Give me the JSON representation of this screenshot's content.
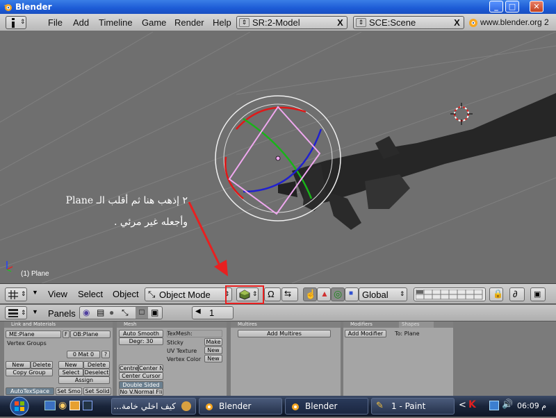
{
  "window": {
    "title": "Blender",
    "min_glyph": "_",
    "max_glyph": "□",
    "close_glyph": "✕"
  },
  "menubar": {
    "items": [
      "File",
      "Add",
      "Timeline",
      "Game",
      "Render",
      "Help"
    ],
    "screen_field": "SR:2-Model",
    "scene_field": "SCE:Scene",
    "close_glyph": "X",
    "dd_glyph": "⇕",
    "url": "www.blender.org 2"
  },
  "viewport": {
    "annotation_line1": "٢ إذهب هنا ثم أقلب الـ Plane",
    "annotation_line2": "وأجعله غير مرئي .",
    "object_label": "(1) Plane",
    "colors": {
      "background": "#6f6f6f",
      "arrow": "#e82020"
    }
  },
  "header3d": {
    "view": "View",
    "select": "Select",
    "object": "Object",
    "mode": "Object Mode",
    "orientation": "Global"
  },
  "buttons_header": {
    "panels": "Panels",
    "frame": "1"
  },
  "panels": {
    "link_materials": {
      "title": "Link and Materials",
      "me": "ME:Plane",
      "f": "F",
      "ob": "OB:Plane",
      "vertex_groups": "Vertex Groups",
      "mat": "0 Mat 0",
      "q": "?",
      "new1": "New",
      "delete1": "Delete",
      "copy_group": "Copy Group",
      "new2": "New",
      "delete2": "Delete",
      "select": "Select",
      "deselect": "Deselect",
      "assign": "Assign",
      "autotex": "AutoTexSpace",
      "set_smo": "Set Smo",
      "set_solid": "Set Solid"
    },
    "mesh": {
      "title": "Mesh",
      "auto_smooth": "Auto Smooth",
      "degr": "Degr: 30",
      "texmesh": "TexMesh:",
      "sticky": "Sticky",
      "make": "Make",
      "uv_texture": "UV Texture",
      "new_uv": "New",
      "vertex_color": "Vertex Color",
      "new_vc": "New",
      "centre": "Centre",
      "center_new": "Center Ne",
      "center_cursor": "Center Cursor",
      "double_sided": "Double Sided",
      "no_vnormal": "No V.Normal Fli"
    },
    "multires": {
      "title": "Multires",
      "add": "Add Multires"
    },
    "modifiers": {
      "tab1": "Modifiers",
      "tab2": "Shapes",
      "add": "Add Modifier",
      "to": "To: Plane"
    }
  },
  "taskbar": {
    "tasks": [
      "كيف اخلي خامة...",
      "Blender",
      "Blender",
      "1 - Paint"
    ],
    "arrow": "<",
    "clock": "06:09 م"
  }
}
